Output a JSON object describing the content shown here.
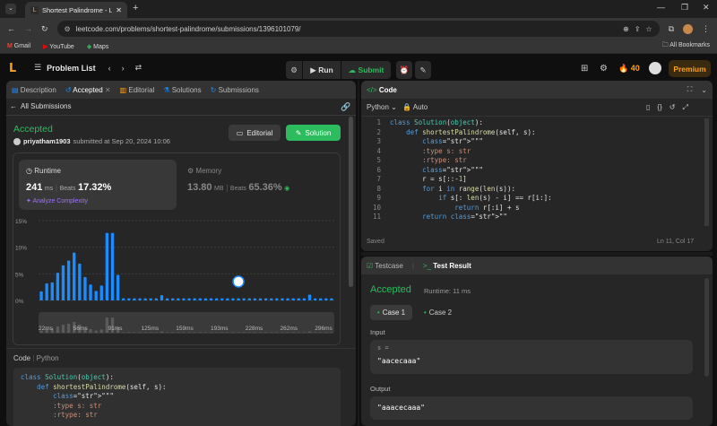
{
  "browser": {
    "tab_title": "Shortest Palindrome - LeetCode",
    "url": "leetcode.com/problems/shortest-palindrome/submissions/1396101079/",
    "bookmarks": [
      "Gmail",
      "YouTube",
      "Maps"
    ],
    "all_bookmarks": "All Bookmarks"
  },
  "nav": {
    "problem_list": "Problem List",
    "run": "Run",
    "submit": "Submit",
    "streak": "40",
    "premium": "Premium"
  },
  "left": {
    "tabs": [
      "Description",
      "Accepted",
      "Editorial",
      "Solutions",
      "Submissions"
    ],
    "all_submissions": "All Submissions",
    "status": "Accepted",
    "user": "priyatham1903",
    "submitted": "submitted at Sep 20, 2024 10:06",
    "editorial_btn": "Editorial",
    "solution_btn": "Solution",
    "runtime": {
      "label": "Runtime",
      "value": "241",
      "unit": "ms",
      "beats_label": "Beats",
      "beats": "17.32%",
      "analyze": "Analyze Complexity"
    },
    "memory": {
      "label": "Memory",
      "value": "13.80",
      "unit": "MB",
      "beats_label": "Beats",
      "beats": "65.36%"
    },
    "code_tabs": [
      "Code",
      "Python"
    ],
    "code_preview": [
      "class Solution(object):",
      "    def shortestPalindrome(self, s):",
      "        \"\"\"",
      "        :type s: str",
      "        :rtype: str"
    ]
  },
  "chart_data": {
    "type": "bar",
    "title": "",
    "ylim": [
      0,
      15
    ],
    "y_ticks": [
      "15%",
      "10%",
      "5%",
      "0%"
    ],
    "x_ticks": [
      "22ms",
      "56ms",
      "91ms",
      "125ms",
      "159ms",
      "193ms",
      "228ms",
      "262ms",
      "296ms"
    ],
    "values": [
      1.7,
      3.2,
      3.4,
      5.2,
      6.6,
      7.5,
      9.0,
      6.9,
      4.4,
      3.0,
      1.8,
      2.8,
      12.7,
      12.7,
      4.8,
      0.4,
      0.4,
      0.4,
      0.4,
      0.4,
      0.4,
      0.4,
      1.0,
      0.4,
      0.4,
      0.4,
      0.4,
      0.4,
      0.4,
      0.4,
      0.4,
      0.4,
      0.4,
      0.4,
      0.4,
      0.4,
      0.4,
      0.4,
      0.4,
      0.4,
      0.4,
      0.4,
      0.4,
      0.4,
      0.4,
      0.4,
      0.4,
      0.4,
      0.4,
      1.1,
      0.4,
      0.4,
      0.4,
      0.4
    ],
    "marker_index": 36,
    "colors": {
      "bar": "#1a8cff",
      "highlight": "#ffffff"
    }
  },
  "editor": {
    "title": "Code",
    "language": "Python",
    "mode": "Auto",
    "lines": [
      "class Solution(object):",
      "    def shortestPalindrome(self, s):",
      "        \"\"\"",
      "        :type s: str",
      "        :rtype: str",
      "        \"\"\"",
      "        r = s[::-1]",
      "        for i in range(len(s)):",
      "            if s[: len(s) - i] == r[i:]:",
      "                return r[:i] + s",
      "        return \"\""
    ],
    "saved": "Saved",
    "cursor": "Ln 11, Col 17"
  },
  "result": {
    "tab_testcase": "Testcase",
    "tab_result": "Test Result",
    "status": "Accepted",
    "runtime": "Runtime: 11 ms",
    "cases": [
      "Case 1",
      "Case 2"
    ],
    "input_label": "Input",
    "var": "s =",
    "input": "\"aacecaaa\"",
    "output_label": "Output",
    "output": "\"aaacecaaa\""
  }
}
